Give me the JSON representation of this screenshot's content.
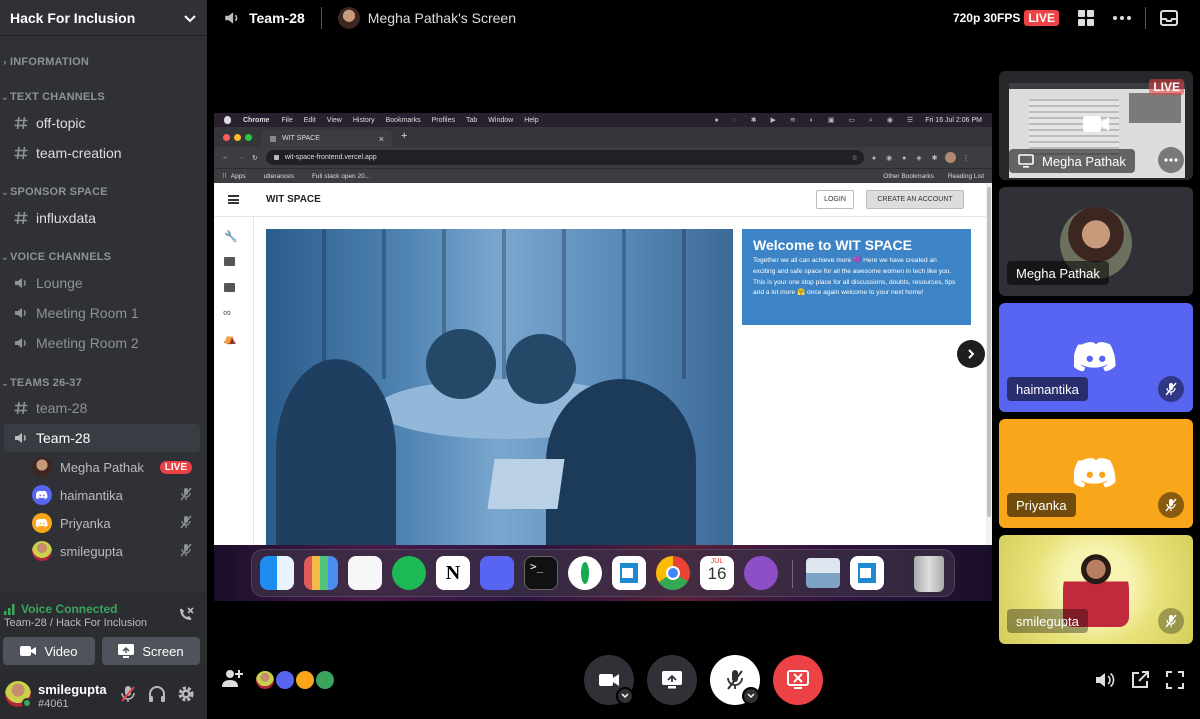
{
  "server": {
    "name": "Hack For Inclusion"
  },
  "categories": {
    "information": "INFORMATION",
    "text": "TEXT CHANNELS",
    "sponsor": "SPONSOR SPACE",
    "voice": "VOICE CHANNELS",
    "teams": "TEAMS 26-37"
  },
  "channels": {
    "off_topic": "off-topic",
    "team_creation": "team-creation",
    "influxdata": "influxdata",
    "lounge": "Lounge",
    "meeting1": "Meeting Room 1",
    "meeting2": "Meeting Room 2",
    "team28_text": "team-28",
    "team28_voice": "Team-28"
  },
  "voice_users": [
    {
      "name": "Megha Pathak",
      "badge": "LIVE"
    },
    {
      "name": "haimantika"
    },
    {
      "name": "Priyanka"
    },
    {
      "name": "smilegupta"
    }
  ],
  "voice": {
    "status": "Voice Connected",
    "location": "Team-28 / Hack For Inclusion",
    "video_label": "Video",
    "screen_label": "Screen"
  },
  "user": {
    "name": "smilegupta",
    "tag": "#4061"
  },
  "topbar": {
    "channel": "Team-28",
    "screen_title": "Megha Pathak's Screen",
    "quality": "720p 30FPS",
    "live": "LIVE"
  },
  "stream": {
    "menubar": {
      "app": "Chrome",
      "items": [
        "File",
        "Edit",
        "View",
        "History",
        "Bookmarks",
        "Profiles",
        "Tab",
        "Window",
        "Help"
      ],
      "clock": "Fri 16 Jul  2:06 PM"
    },
    "tab_title": "WIT SPACE",
    "url": "wit-space-frontend.vercel.app",
    "bookmarks": [
      "Apps",
      "utterances",
      "Full stack open 20..."
    ],
    "bookmarks_right": [
      "Other Bookmarks",
      "Reading List"
    ],
    "site": {
      "brand": "WIT SPACE",
      "login": "LOGIN",
      "signup": "CREATE AN ACCOUNT",
      "welcome_title": "Welcome to WIT SPACE",
      "welcome_body": "Together we all can achieve more 💜 Here we have created an exciting and safe space for all the awesome women in tech like you. This is your one stop place for all discussions, doubts, resources, tips and a lot more 🤗 once again welcome to your next home!"
    },
    "dock_date": {
      "month": "JUL",
      "day": "16"
    }
  },
  "tiles": [
    {
      "name": "Megha Pathak",
      "live": "LIVE"
    },
    {
      "name": "Megha Pathak"
    },
    {
      "name": "haimantika",
      "color": "#5865f2"
    },
    {
      "name": "Priyanka",
      "color": "#faa61a"
    },
    {
      "name": "smilegupta"
    }
  ]
}
